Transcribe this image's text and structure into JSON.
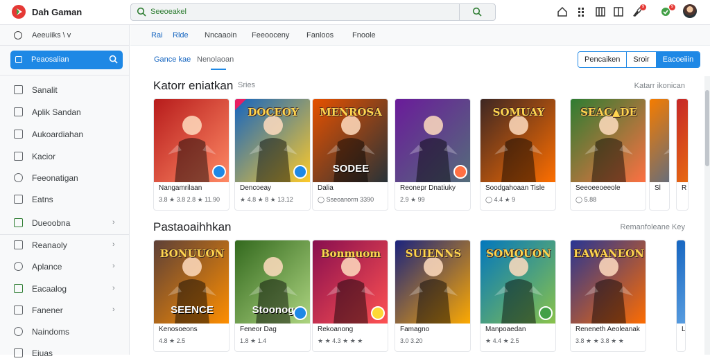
{
  "app": {
    "title": "Dah Gaman"
  },
  "search": {
    "value": "Seeoeakel"
  },
  "toolbar_icons": [
    "home-icon",
    "apps-icon",
    "library-icon",
    "brush-icon",
    "shield-icon"
  ],
  "notifications": {
    "brush": "9",
    "shield": "9"
  },
  "sidebar": {
    "account_label": "Aeeuiiks \\ v",
    "search_label": "Peaosalian",
    "items": [
      {
        "label": "Sanalit",
        "icon": "home-icon"
      },
      {
        "label": "Aplik Sandan",
        "icon": "apps-icon"
      },
      {
        "label": "Aukoardiahan",
        "icon": "book-icon"
      },
      {
        "label": "Kacior",
        "icon": "kids-icon"
      },
      {
        "label": "Feeonatigan",
        "icon": "gift-icon"
      },
      {
        "label": "Eatns",
        "icon": "grid-icon"
      }
    ],
    "groups": [
      {
        "label": "Dueoobna",
        "icon": "games-icon",
        "chevron": "›"
      },
      {
        "label": "Reanaoly",
        "icon": "chart-icon",
        "chevron": "›"
      },
      {
        "label": "Aplance",
        "icon": "settings-icon",
        "chevron": "›"
      },
      {
        "label": "Eacaalog",
        "icon": "shop-icon",
        "chevron": "›"
      },
      {
        "label": "Fanener",
        "icon": "payment-icon",
        "chevron": "›"
      },
      {
        "label": "Naindoms",
        "icon": "help-icon",
        "chevron": ""
      },
      {
        "label": "Eiuas",
        "icon": "info-icon",
        "chevron": ""
      }
    ]
  },
  "top_tabs": [
    "Rai",
    "Rlde",
    "Nncaaoin",
    "Feeooceny",
    "Fanloos",
    "Fnoole"
  ],
  "sub_tabs": [
    "Gance kae",
    "Nenolaoan"
  ],
  "segmented": [
    "Pencaiken",
    "Sroir",
    "Eacoeiiin"
  ],
  "sections": [
    {
      "title": "Katorr eniatkan",
      "subtitle": "Sries",
      "more": "Katarr ikonican",
      "cards": [
        {
          "name": "Nangamrilaan",
          "meta": "3.8 ★ 3.8   2.8 ★ 11.90",
          "badge": "blue",
          "art": [
            "#b71c1c",
            "#ff8a65"
          ]
        },
        {
          "name": "Dencoeay",
          "meta": "★ 4.8 ★ 8 ★ 13.12",
          "badge": "blue",
          "art": [
            "#1565c0",
            "#ffca28"
          ],
          "label": "DOCEOY"
        },
        {
          "name": "Dalia",
          "meta": "◯ Sseoanorm  3390",
          "badge": "",
          "art": [
            "#e65100",
            "#263238"
          ],
          "label": "MENROSA",
          "label2": "SODEE"
        },
        {
          "name": "Reonepr Dnatiuky",
          "meta": "2.9 ★ 99",
          "badge": "orange",
          "art": [
            "#6a1b9a",
            "#546e7a"
          ]
        },
        {
          "name": "Soodgahoaan Tisle",
          "meta": "◯ 4.4 ★ 9",
          "badge": "",
          "art": [
            "#3e2723",
            "#ff6f00"
          ],
          "label": "SOMUAY"
        },
        {
          "name": "Seeoeeoeeole",
          "meta": "◯ 5.88",
          "badge": "",
          "art": [
            "#2e7d32",
            "#ff7043"
          ],
          "label": "SEAC▲DE"
        },
        {
          "name": "Sl",
          "meta": "",
          "badge": "",
          "art": [
            "#f57c00",
            "#1565c0"
          ]
        },
        {
          "name": "R",
          "meta": "",
          "badge": "",
          "art": [
            "#c62828",
            "#ff9800"
          ]
        }
      ]
    },
    {
      "title": "Pastaoaihhkan",
      "subtitle": "",
      "more": "Remanfoleane Key",
      "cards": [
        {
          "name": "Kenosoeons",
          "meta": "4.8 ★ 2.5",
          "badge": "",
          "art": [
            "#5d4037",
            "#ff8f00"
          ],
          "label": "BONUUON",
          "label2": "SEENCE"
        },
        {
          "name": "Feneor Dag",
          "meta": "1.8 ★ 1.4",
          "badge": "blue",
          "art": [
            "#33691e",
            "#aed581"
          ],
          "label2": "Stoonog"
        },
        {
          "name": "Rekoanong",
          "meta": "★ ★ 4.3 ★ ★ ★",
          "badge": "yellow",
          "art": [
            "#880e4f",
            "#ff5252"
          ],
          "label": "Bonmuom"
        },
        {
          "name": "Famagno",
          "meta": "3.0 3.20",
          "badge": "",
          "art": [
            "#1a237e",
            "#ffab00"
          ],
          "label": "SUIENNS"
        },
        {
          "name": "Manpoaedan",
          "meta": "★ 4.4 ★ 2.5",
          "badge": "green",
          "art": [
            "#0277bd",
            "#8bc34a"
          ],
          "label": "SOMOUON"
        },
        {
          "name": "Reneneth Aeoleanak",
          "meta": "3.8 ★ ★ 3.8 ★ ★",
          "badge": "",
          "art": [
            "#283593",
            "#ff6d00"
          ],
          "label": "EAWANEON"
        },
        {
          "name": "L",
          "meta": "",
          "badge": "",
          "art": [
            "#1565c0",
            "#90caf9"
          ]
        }
      ]
    }
  ],
  "colors": {
    "accent": "#1e88e5",
    "text": "#202124",
    "muted": "#5f6368"
  }
}
